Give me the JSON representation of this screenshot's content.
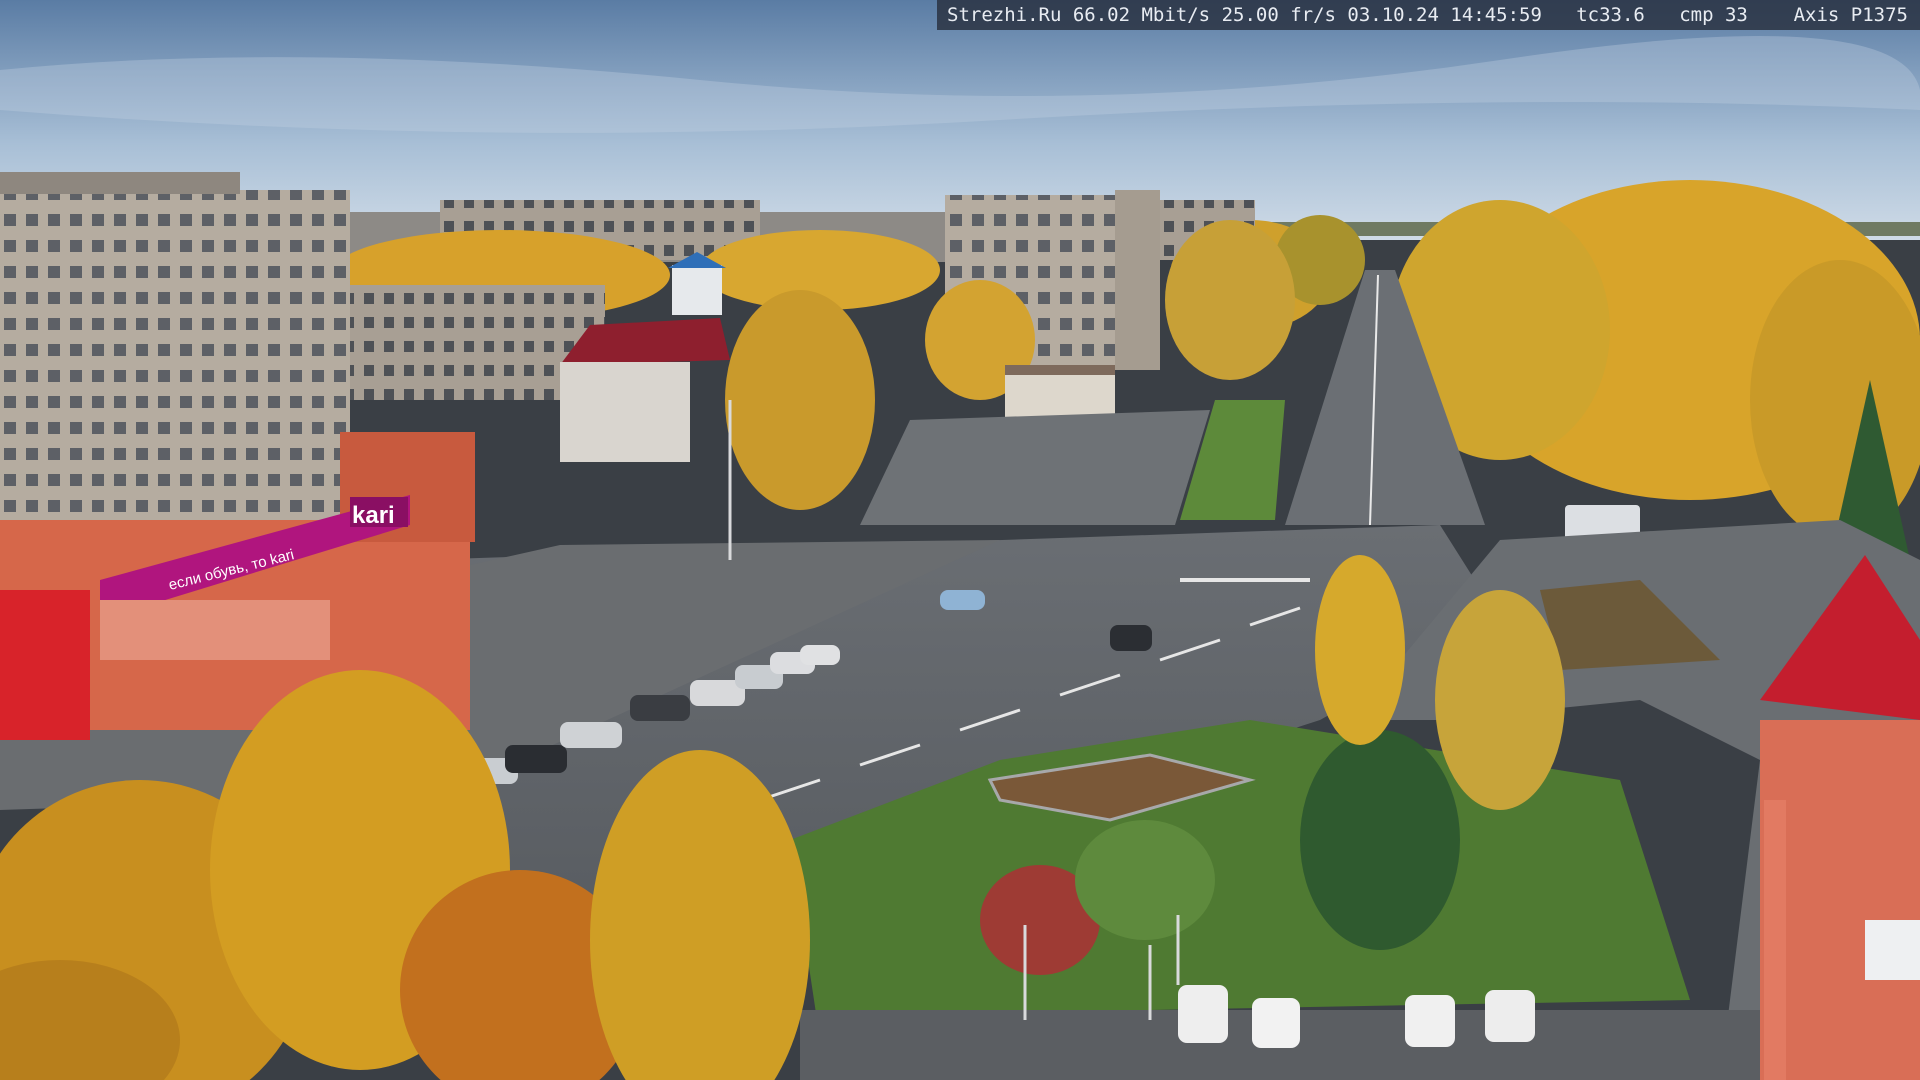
{
  "overlay": {
    "site": "Strezhi.Ru",
    "bitrate": "66.02 Mbit/s",
    "framerate": "25.00 fr/s",
    "date": "03.10.24",
    "time": "14:45:59",
    "tc": "tc33.6",
    "cmp": "cmp 33",
    "camera": "Axis P1375"
  },
  "signage": {
    "store_brand": "kari",
    "store_slogan": "если обувь, то kari"
  },
  "colors": {
    "sky_top": "#5d7fa6",
    "sky_bottom": "#c7d6e6",
    "asphalt": "#5c6066",
    "foliage_gold": "#d9a32a",
    "lawn": "#4f7a32",
    "brick": "#d6674a",
    "magenta_sign": "#b0157e",
    "roof_red": "#c41e2e"
  }
}
